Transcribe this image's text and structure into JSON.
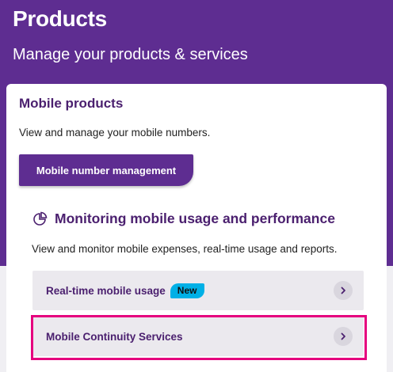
{
  "header": {
    "title": "Products",
    "subtitle": "Manage your products & services"
  },
  "mobile_products": {
    "title": "Mobile products",
    "description": "View and manage your mobile numbers.",
    "button_label": "Mobile number management"
  },
  "monitoring": {
    "icon": "pie-chart-icon",
    "title": "Monitoring mobile usage and performance",
    "description": "View and monitor mobile expenses, real-time usage and reports."
  },
  "links": [
    {
      "label": "Real-time mobile usage",
      "badge": "New",
      "icon": "chevron-right-icon"
    },
    {
      "label": "Mobile Continuity Services",
      "icon": "chevron-right-icon"
    }
  ],
  "colors": {
    "brand_purple": "#5e2d91",
    "heading_purple": "#4b206f",
    "badge_blue": "#00b0e6",
    "highlight_pink": "#e5007e",
    "link_bg": "#ebe9ee"
  }
}
